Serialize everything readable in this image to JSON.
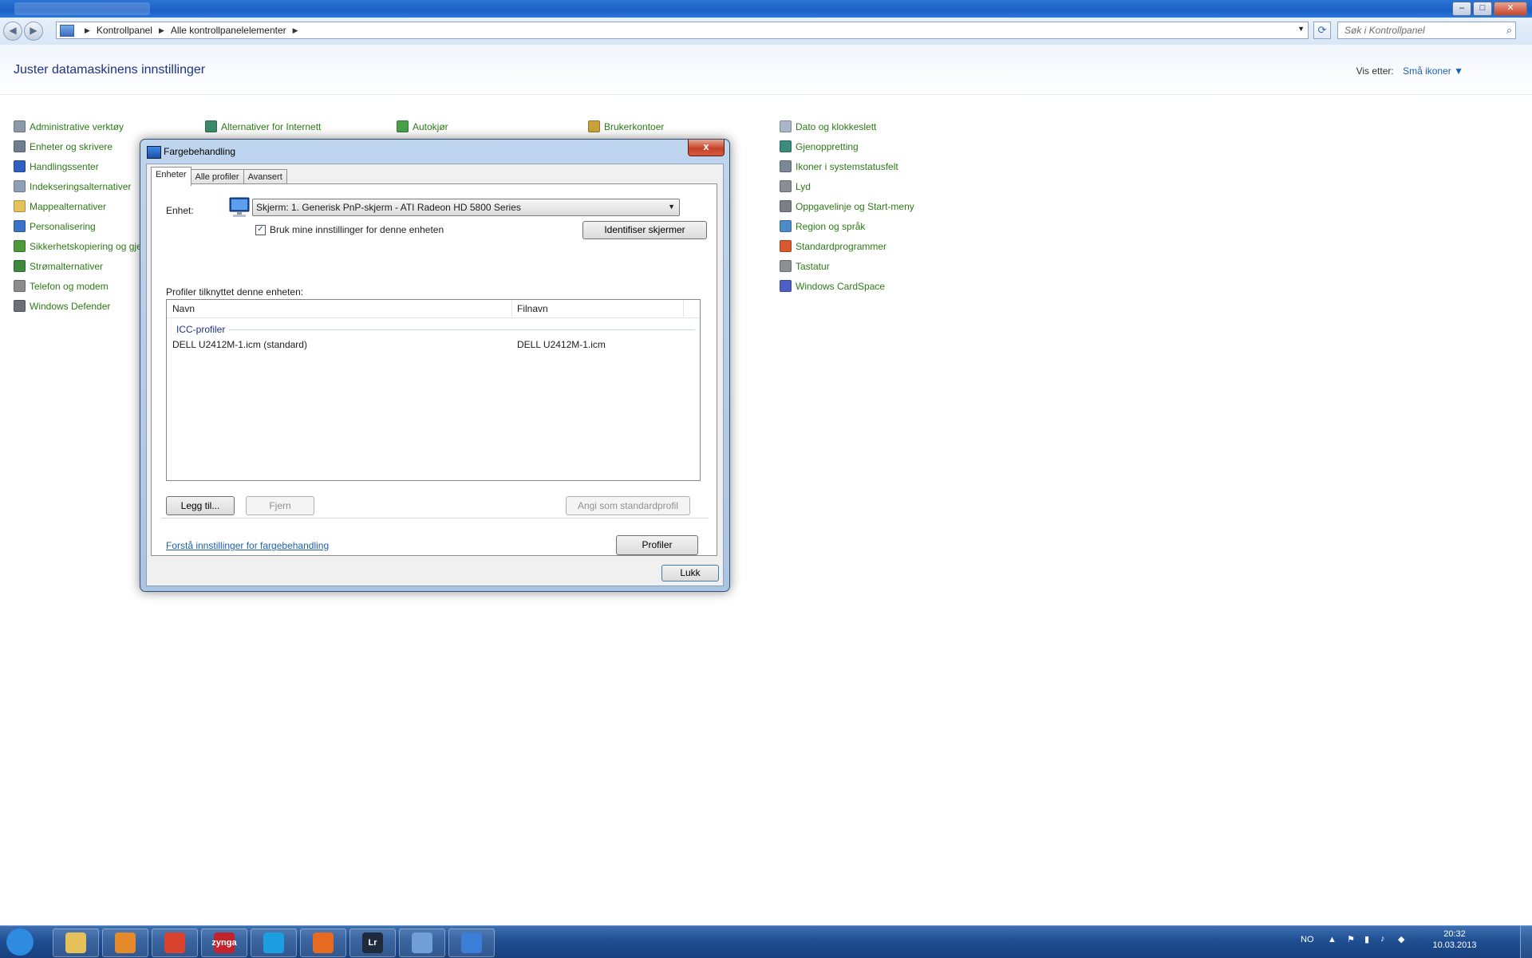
{
  "window": {
    "controls": {
      "minimize": "–",
      "maximize": "□",
      "close": "✕"
    }
  },
  "address": {
    "crumbs": [
      "Kontrollpanel",
      "Alle kontrollpanelelementer"
    ],
    "search_placeholder": "Søk i Kontrollpanel"
  },
  "header": {
    "title": "Juster datamaskinens innstillinger",
    "view_by_label": "Vis etter:",
    "view_by_value": "Små ikoner"
  },
  "control_panel": {
    "col1": [
      {
        "label": "Administrative verktøy",
        "icon": "tools-icon",
        "color": "#8a9aa8"
      },
      {
        "label": "Enheter og skrivere",
        "icon": "printer-icon",
        "color": "#6f7f8f"
      },
      {
        "label": "Handlingssenter",
        "icon": "flag-icon",
        "color": "#2f5fbf"
      },
      {
        "label": "Indekseringsalternativer",
        "icon": "search-index-icon",
        "color": "#8fa0b6"
      },
      {
        "label": "Mappealternativer",
        "icon": "folder-icon",
        "color": "#e5c25a"
      },
      {
        "label": "Personalisering",
        "icon": "monitor-paint-icon",
        "color": "#3a72c6"
      },
      {
        "label": "Sikkerhetskopiering og gjenoppretting",
        "icon": "backup-icon",
        "color": "#4e9a3a"
      },
      {
        "label": "Strømalternativer",
        "icon": "power-icon",
        "color": "#3d8a3d"
      },
      {
        "label": "Telefon og modem",
        "icon": "phone-icon",
        "color": "#8c8c8c"
      },
      {
        "label": "Windows Defender",
        "icon": "defender-icon",
        "color": "#6a6f78"
      }
    ],
    "col2": [
      {
        "label": "Alternativer for Internett",
        "icon": "internet-options-icon",
        "color": "#3c8a6a"
      }
    ],
    "col3": [
      {
        "label": "Autokjør",
        "icon": "autoplay-icon",
        "color": "#4aa04a"
      }
    ],
    "col4": [
      {
        "label": "Brukerkontoer",
        "icon": "users-icon",
        "color": "#c9a23a"
      }
    ],
    "col5": [
      {
        "label": "Dato og klokkeslett",
        "icon": "clock-icon",
        "color": "#a9b7c9"
      },
      {
        "label": "Gjenoppretting",
        "icon": "recovery-icon",
        "color": "#3b8c7c"
      },
      {
        "label": "Ikoner i systemstatusfelt",
        "icon": "tray-icon",
        "color": "#7d8896"
      },
      {
        "label": "Lyd",
        "icon": "speaker-icon",
        "color": "#8a8f96"
      },
      {
        "label": "Oppgavelinje og Start-meny",
        "icon": "taskbar-icon",
        "color": "#7a7f88"
      },
      {
        "label": "Region og språk",
        "icon": "globe-icon",
        "color": "#4c8bc7"
      },
      {
        "label": "Standardprogrammer",
        "icon": "default-programs-icon",
        "color": "#d9582e"
      },
      {
        "label": "Tastatur",
        "icon": "keyboard-icon",
        "color": "#8c8f93"
      },
      {
        "label": "Windows CardSpace",
        "icon": "cardspace-icon",
        "color": "#4c5fc4"
      }
    ]
  },
  "dialog": {
    "title": "Fargebehandling",
    "close": "x",
    "tabs": [
      "Enheter",
      "Alle profiler",
      "Avansert"
    ],
    "device_label": "Enhet:",
    "device_value": "Skjerm: 1. Generisk PnP-skjerm - ATI Radeon HD 5800 Series",
    "use_settings_label": "Bruk mine innstillinger for denne enheten",
    "use_settings_checked": true,
    "identify_button": "Identifiser skjermer",
    "profiles_label": "Profiler tilknyttet denne enheten:",
    "columns": [
      "Navn",
      "Filnavn"
    ],
    "group": "ICC-profiler",
    "rows": [
      {
        "name": "DELL U2412M-1.icm (standard)",
        "file": "DELL U2412M-1.icm"
      }
    ],
    "add_button": "Legg til...",
    "remove_button": "Fjern",
    "default_button": "Angi som standardprofil",
    "help_link": "Forstå innstillinger for fargebehandling",
    "profiles_button": "Profiler",
    "close_button": "Lukk"
  },
  "taskbar": {
    "pinned": [
      {
        "name": "start-button",
        "color": "#2f8be0"
      },
      {
        "name": "explorer-icon",
        "color": "#e6c15a"
      },
      {
        "name": "media-player-icon",
        "color": "#e58a2a"
      },
      {
        "name": "chrome-icon",
        "color": "#d9432f"
      },
      {
        "name": "zynga-icon",
        "color": "#c4232c",
        "text": "zynga"
      },
      {
        "name": "skype-icon",
        "color": "#1d9ee0"
      },
      {
        "name": "firefox-icon",
        "color": "#e66a1f"
      },
      {
        "name": "lightroom-icon",
        "color": "#1f2b3c",
        "text": "Lr"
      },
      {
        "name": "control-panel-icon",
        "color": "#6f9fd6"
      },
      {
        "name": "color-management-icon",
        "color": "#3a7ed6"
      }
    ],
    "lang": "NO",
    "time": "20:32",
    "date": "10.03.2013"
  }
}
